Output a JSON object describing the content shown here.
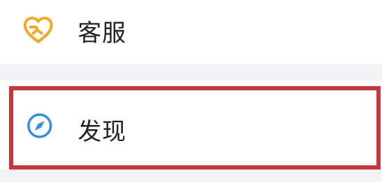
{
  "menu": {
    "items": [
      {
        "label": "客服",
        "icon": "heart-handshake-icon",
        "icon_color": "#f5a623"
      },
      {
        "label": "发现",
        "icon": "compass-icon",
        "icon_color": "#2f8fe8"
      }
    ]
  },
  "highlight": {
    "target": "发现",
    "color": "#c8363a"
  },
  "colors": {
    "background": "#ffffff",
    "separator": "#f3f3f5",
    "text": "#222222"
  }
}
